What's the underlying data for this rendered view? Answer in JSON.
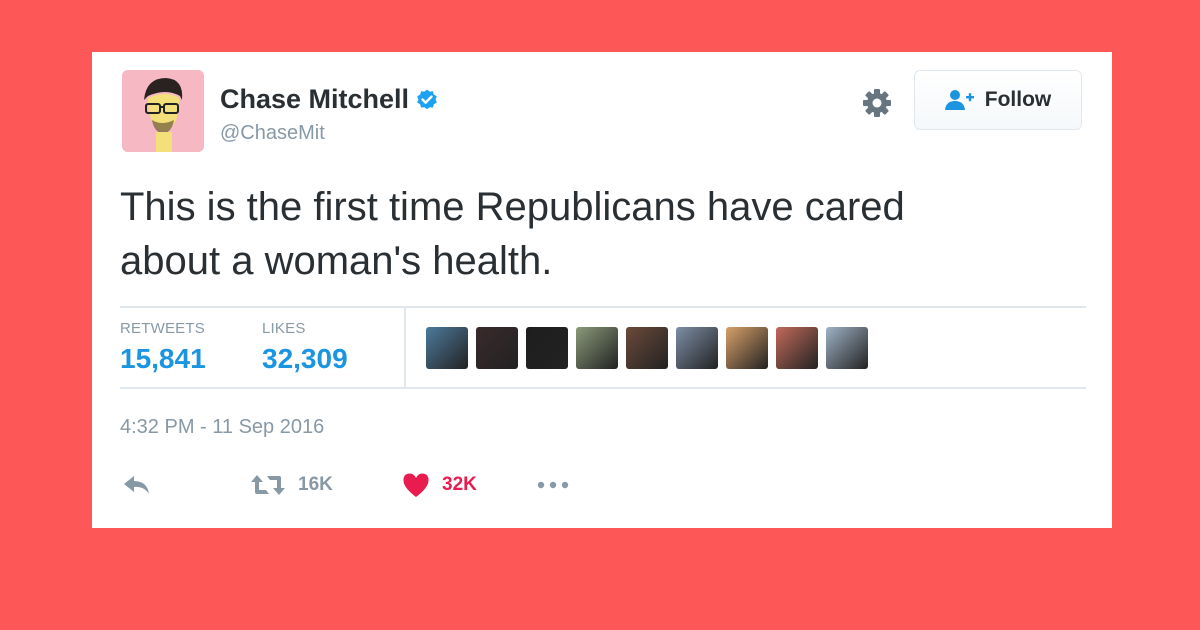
{
  "user": {
    "display_name": "Chase Mitchell",
    "handle": "@ChaseMit",
    "verified": true
  },
  "follow_button": {
    "label": "Follow"
  },
  "tweet": {
    "lines": [
      "This is the first time Republicans have cared",
      "about a woman's health."
    ],
    "timestamp": "4:32 PM - 11 Sep 2016"
  },
  "stats": {
    "retweets_label": "RETWEETS",
    "retweets_value": "15,841",
    "likes_label": "LIKES",
    "likes_value": "32,309"
  },
  "liker_avatars": [
    {
      "color": "#4d7a9c"
    },
    {
      "color": "#3a2a2c"
    },
    {
      "color": "#1e1e1e"
    },
    {
      "color": "#8a9a7a"
    },
    {
      "color": "#6b4a3a"
    },
    {
      "color": "#7d8ea6"
    },
    {
      "color": "#d9a06a"
    },
    {
      "color": "#c26a5a"
    },
    {
      "color": "#9fb2c6"
    }
  ],
  "actions": {
    "reply_icon": "reply-icon",
    "retweet_icon": "retweet-icon",
    "retweet_count": "16K",
    "like_icon": "heart-icon",
    "like_count": "32K",
    "more_icon": "more-dots-icon"
  },
  "colors": {
    "background": "#fe5757",
    "link_blue": "#1b95e0",
    "like_red": "#e81c4f",
    "verified_blue": "#1da1f2"
  }
}
